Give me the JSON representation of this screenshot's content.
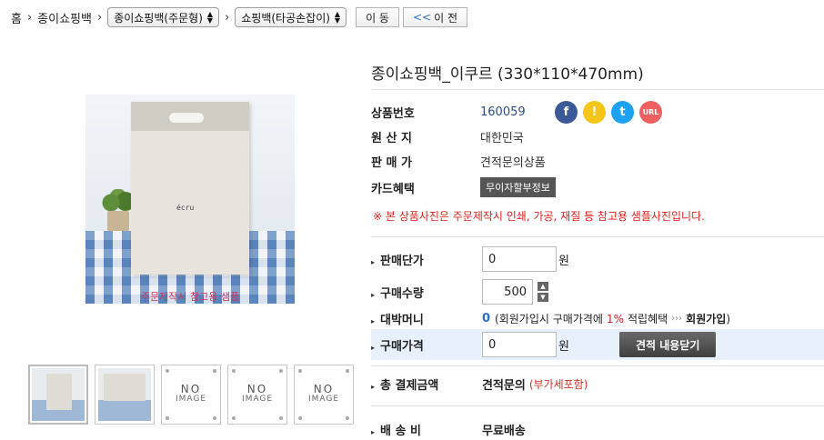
{
  "breadcrumb": {
    "home": "홈",
    "category": "종이쇼핑백",
    "select1": "종이쇼핑백(주문형)",
    "select2": "쇼핑백(타공손잡이)",
    "move_label": "이 동",
    "prev_label": "이 전",
    "prev_chevron": "<<"
  },
  "gallery": {
    "bag_logo": "écru",
    "sample_caption": "주문제작시 참고용 샘플",
    "thumbnails": [
      {
        "type": "photo",
        "icon": "bag-photo"
      },
      {
        "type": "photo",
        "icon": "bag-photo"
      },
      {
        "type": "no_image",
        "line1": "NO",
        "line2": "IMAGE"
      },
      {
        "type": "no_image",
        "line1": "NO",
        "line2": "IMAGE"
      },
      {
        "type": "no_image",
        "line1": "NO",
        "line2": "IMAGE"
      }
    ]
  },
  "product": {
    "title": "종이쇼핑백_이쿠르 (330*110*470mm)",
    "code_label": "상품번호",
    "code": "160059",
    "origin_label": "원 산 지",
    "origin": "대한민국",
    "price_label": "판 매 가",
    "price": "견적문의상품",
    "card_label": "카드혜택",
    "card_badge": "무이자할부정보",
    "notice": "※ 본 상품사진은 주문제작시 인쇄, 가공, 재질 등 참고용 샘플사진입니다.",
    "share": {
      "facebook": "f",
      "kakaostory": "!",
      "twitter": "t",
      "url": "URL"
    }
  },
  "purchase": {
    "unit_price_label": "판매단가",
    "unit_price_value": "0",
    "unit": "원",
    "qty_label": "구매수량",
    "qty_value": "500",
    "money_label": "대박머니",
    "money_value": "0",
    "money_desc_pre": "(회원가입시 구매가격에",
    "money_rate": "1%",
    "money_desc_mid": "적립혜택",
    "money_arrows": "›››",
    "money_join": "회원가입",
    "money_close": ")",
    "total_price_label": "구매가격",
    "total_price_value": "0",
    "estimate_button": "견적 내용닫기",
    "payment_label": "총 결제금액",
    "payment_value": "견적문의",
    "payment_note": "(부가세포함)",
    "shipping_label": "배 송 비",
    "shipping_value": "무료배송"
  },
  "colors": {
    "accent_blue": "#2e6fc2",
    "notice_red": "#e2221c",
    "highlight_row": "#e8f1fb"
  }
}
